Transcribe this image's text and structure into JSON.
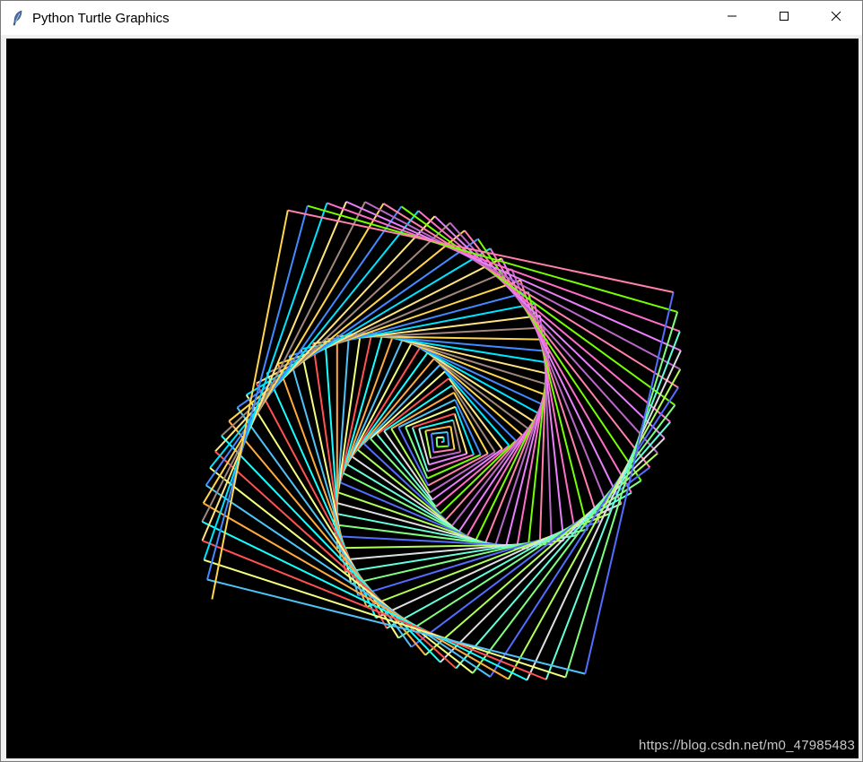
{
  "window": {
    "title": "Python Turtle Graphics",
    "icon": "feather-icon",
    "controls": {
      "minimize_icon": "minimize-icon",
      "maximize_icon": "maximize-icon",
      "close_icon": "close-icon"
    }
  },
  "canvas": {
    "background": "#000000",
    "watermark": "https://blog.csdn.net/m0_47985483",
    "palette": [
      "#ff6ec7",
      "#7fff7f",
      "#4fc3f7",
      "#ffd54f",
      "#ba68c8",
      "#e0e0e0",
      "#ff5252",
      "#00e5ff",
      "#76ff03",
      "#536dfe",
      "#ffab40",
      "#a1887f",
      "#ea80fc",
      "#64ffda",
      "#f4ff81",
      "#448aff",
      "#ff80ab",
      "#b2ff59",
      "#18ffff",
      "#ffe57f"
    ]
  }
}
